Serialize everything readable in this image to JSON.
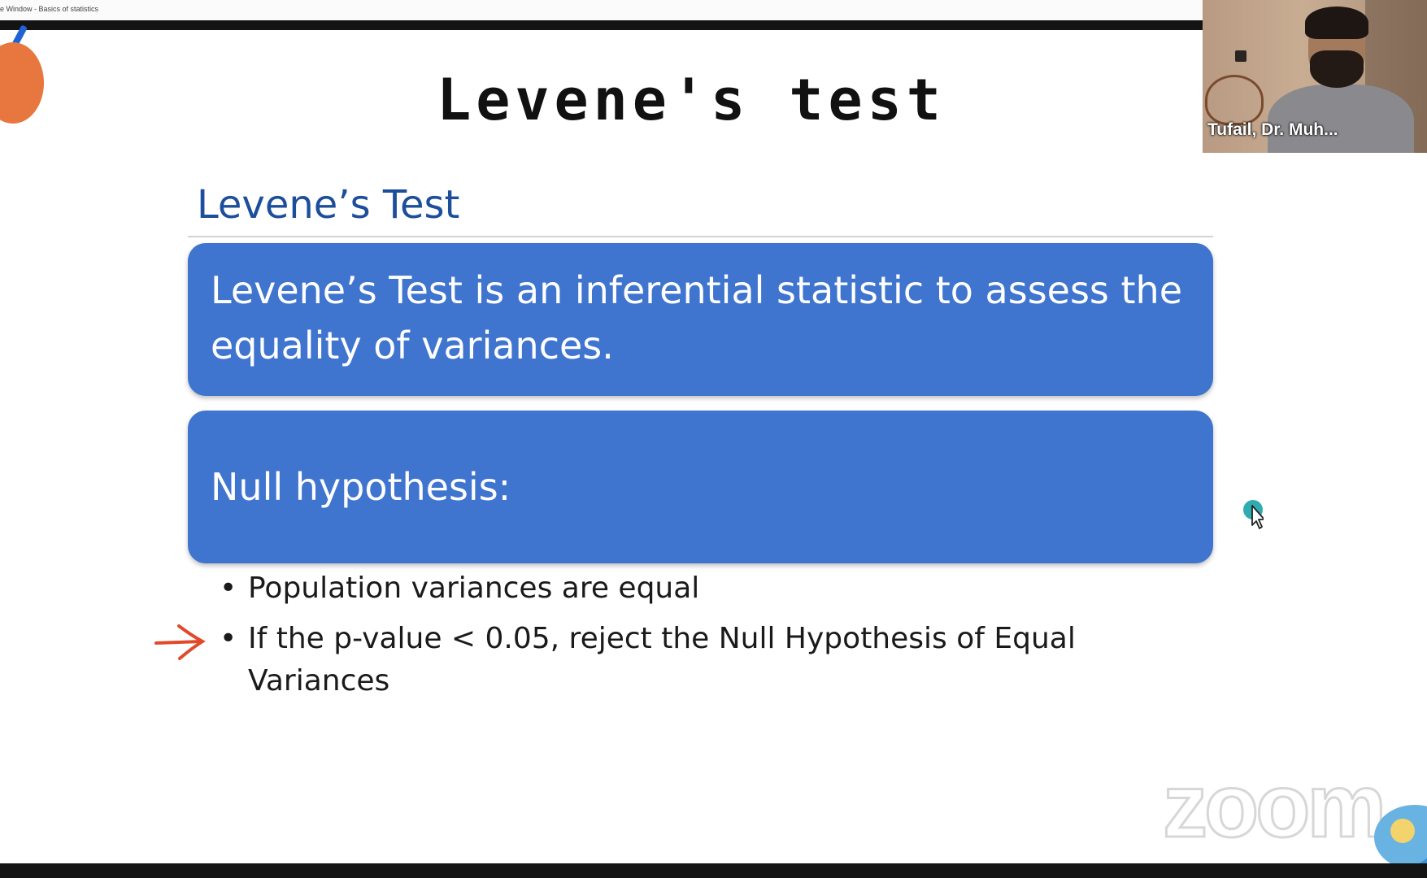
{
  "window": {
    "title": "e Window - Basics of statistics"
  },
  "slide": {
    "title": "Levene's test",
    "heading": "Levene’s Test",
    "box1_text": "Levene’s Test is an inferential statistic to assess the equality of variances.",
    "box2_text": "Null hypothesis:",
    "bullets": [
      "Population variances are equal",
      "If the p-value < 0.05, reject the Null Hypothesis of Equal Variances"
    ]
  },
  "video": {
    "participant_name": "Tufail, Dr. Muh..."
  },
  "watermark": {
    "text": "zoom"
  },
  "colors": {
    "box": "#3f74cf",
    "heading": "#1d4e9c",
    "arrow": "#e04a2b",
    "decor_circle": "#e8773f",
    "cursor": "#1aa3a8"
  },
  "icons": {
    "annotation": "red-arrow-annotation-icon",
    "cursor": "mouse-cursor-icon"
  }
}
